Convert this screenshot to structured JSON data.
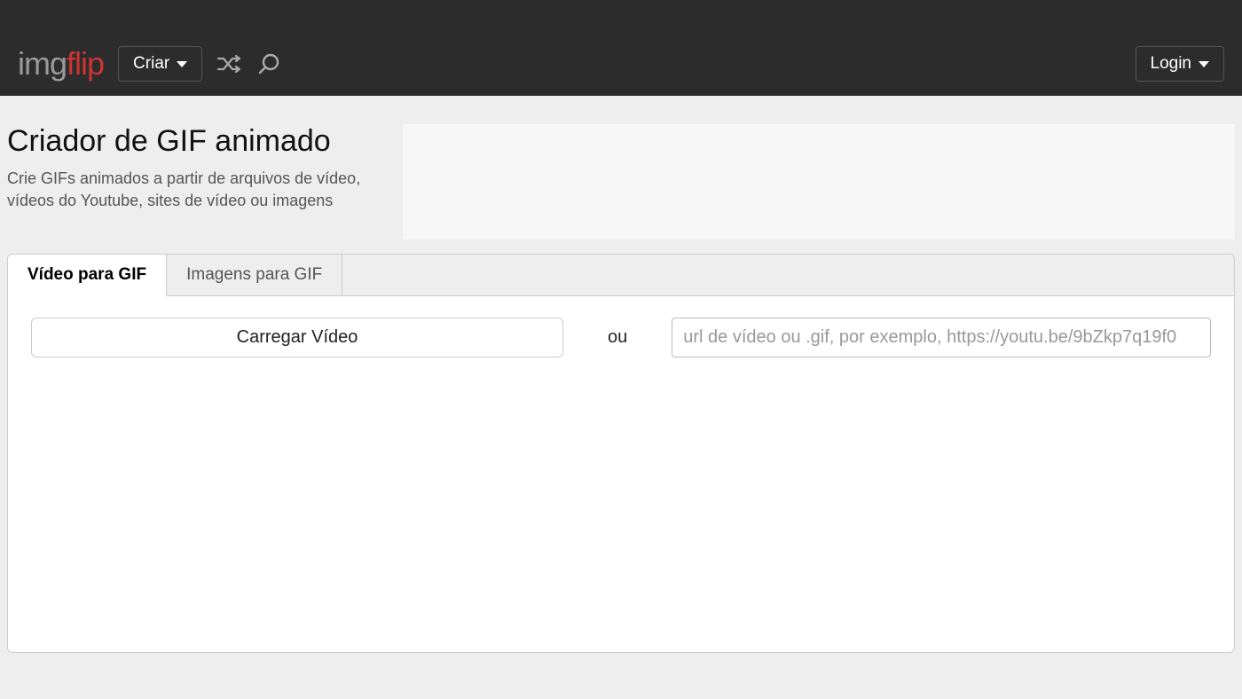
{
  "nav": {
    "logo_img": "img",
    "logo_flip": "flip",
    "create_label": "Criar",
    "login_label": "Login"
  },
  "page": {
    "title": "Criador de GIF animado",
    "subtitle": "Crie GIFs animados a partir de arquivos de vídeo, vídeos do Youtube, sites de vídeo ou imagens"
  },
  "tabs": {
    "video": "Vídeo para GIF",
    "images": "Imagens para GIF"
  },
  "upload": {
    "button_label": "Carregar Vídeo",
    "or": "ou",
    "url_placeholder": "url de vídeo ou .gif, por exemplo, https://youtu.be/9bZkp7q19f0"
  }
}
